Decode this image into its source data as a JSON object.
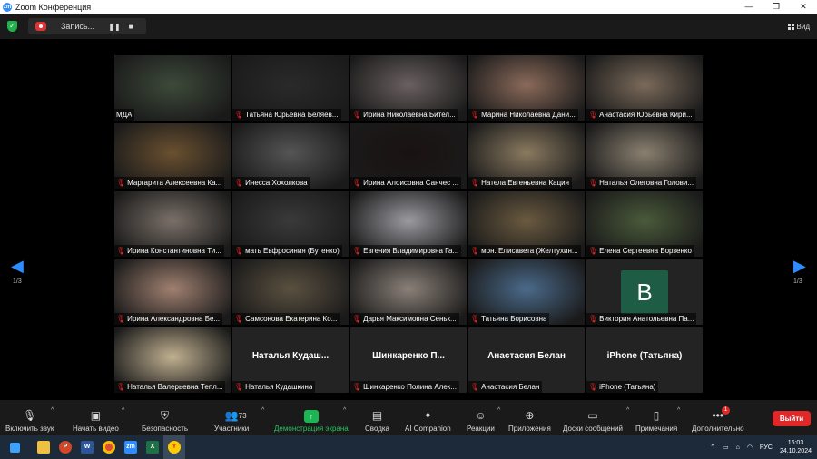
{
  "window": {
    "title": "Zoom Конференция",
    "app_icon": "zm"
  },
  "topbar": {
    "record_label": "Запись...",
    "view_label": "Вид"
  },
  "gallery": {
    "page_left": "1/3",
    "page_right": "1/3",
    "tiles": [
      {
        "name": "МДА",
        "muted": false,
        "active": true,
        "kind": "video",
        "color": "#3d4a3a"
      },
      {
        "name": "Татьяна Юрьевна Беляев...",
        "muted": true,
        "kind": "video",
        "color": "#2a2a2a"
      },
      {
        "name": "Ирина Николаевна Бител...",
        "muted": true,
        "kind": "video",
        "color": "#6a6060"
      },
      {
        "name": "Марина Николаевна Дани...",
        "muted": true,
        "kind": "video",
        "color": "#8a6a5a"
      },
      {
        "name": "Анастасия Юрьевна Кири...",
        "muted": true,
        "kind": "video",
        "color": "#7a6a5a"
      },
      {
        "name": "Маргарита Алексеевна Ка...",
        "muted": true,
        "kind": "video",
        "color": "#6a5030"
      },
      {
        "name": "Инесса Хохолкова",
        "muted": true,
        "kind": "video",
        "color": "#555555"
      },
      {
        "name": "Ирина Алоисовна Санчес ...",
        "muted": true,
        "kind": "video",
        "color": "#1a1212"
      },
      {
        "name": "Натела Евгеньевна Кация",
        "muted": true,
        "kind": "video",
        "color": "#8a7a60"
      },
      {
        "name": "Наталья Олеговна Голови...",
        "muted": true,
        "kind": "video",
        "color": "#8a8070"
      },
      {
        "name": "Ирина Константиновна Ти...",
        "muted": true,
        "kind": "video",
        "color": "#7a7068"
      },
      {
        "name": "мать Евфросиния (Бутенко)",
        "muted": true,
        "kind": "video",
        "color": "#3a3a3a"
      },
      {
        "name": "Евгения Владимировна Га...",
        "muted": true,
        "kind": "video",
        "color": "#9a9aa0"
      },
      {
        "name": "мон. Елисавета (Желтухин...",
        "muted": true,
        "kind": "video",
        "color": "#6a5a40"
      },
      {
        "name": "Елена Сергеевна Борзенко",
        "muted": true,
        "kind": "video",
        "color": "#4a5a3a"
      },
      {
        "name": "Ирина Александровна Бе...",
        "muted": true,
        "kind": "video",
        "color": "#a08070"
      },
      {
        "name": "Самсонова Екатерина Ко...",
        "muted": true,
        "kind": "video",
        "color": "#5a5040"
      },
      {
        "name": "Дарья Максимовна Сеньк...",
        "muted": true,
        "kind": "video",
        "color": "#8a8078"
      },
      {
        "name": "Татьяна Борисовна",
        "muted": true,
        "kind": "video",
        "color": "#4a6a8a"
      },
      {
        "name": "Виктория Анатольевна Па...",
        "muted": true,
        "kind": "avatar",
        "initial": "В"
      },
      {
        "name": "Наталья Валерьевна Тепл...",
        "muted": true,
        "kind": "video",
        "color": "#c0b090"
      },
      {
        "name": "Наталья Кудашкина",
        "muted": true,
        "kind": "text",
        "big": "Наталья  Кудаш..."
      },
      {
        "name": "Шинкаренко Полина Алек...",
        "muted": true,
        "kind": "text",
        "big": "Шинкаренко  П..."
      },
      {
        "name": "Анастасия Белан",
        "muted": true,
        "kind": "text",
        "big": "Анастасия Белан"
      },
      {
        "name": "iPhone (Татьяна)",
        "muted": true,
        "kind": "text",
        "big": "iPhone (Татьяна)"
      }
    ]
  },
  "toolbar": {
    "audio": "Включить звук",
    "video": "Начать видео",
    "security": "Безопасность",
    "participants": "Участники",
    "participants_count": "73",
    "share": "Демонстрация экрана",
    "summary": "Сводка",
    "companion": "AI Companion",
    "reactions": "Реакции",
    "apps": "Приложения",
    "whiteboards": "Доски сообщений",
    "notes": "Примечания",
    "more": "Дополнительно",
    "more_badge": "1",
    "exit": "Выйти"
  },
  "taskbar": {
    "lang": "РУС",
    "time": "16:03",
    "date": "24.10.2024"
  }
}
